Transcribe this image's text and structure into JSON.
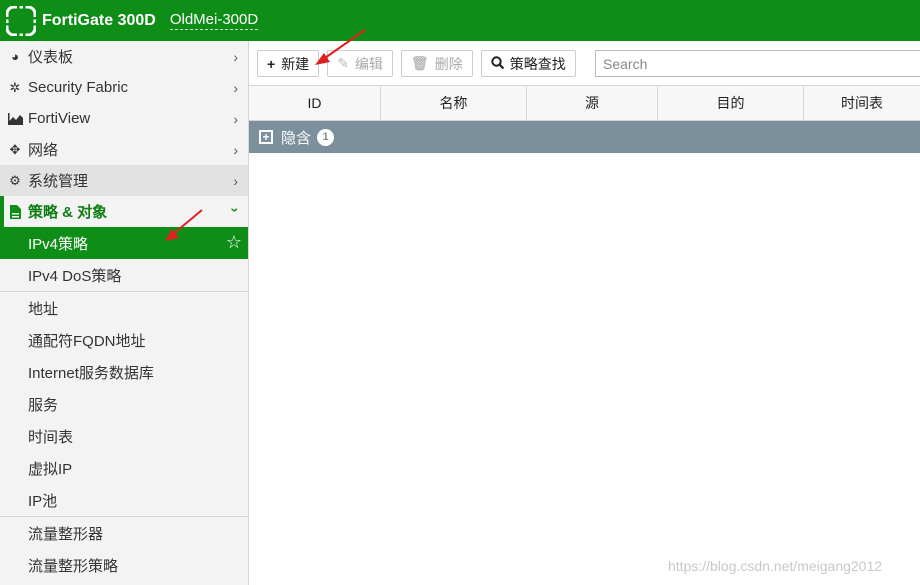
{
  "header": {
    "product": "FortiGate 300D",
    "hostname": "OldMei-300D",
    "accent": "#0e8e17"
  },
  "sidebar": {
    "items": [
      {
        "label": "仪表板",
        "icon": "dashboard-icon"
      },
      {
        "label": "Security Fabric",
        "icon": "security-fabric-icon"
      },
      {
        "label": "FortiView",
        "icon": "fortiview-icon"
      },
      {
        "label": "网络",
        "icon": "network-icon"
      },
      {
        "label": "系统管理",
        "icon": "gear-icon"
      },
      {
        "label": "策略 & 对象",
        "icon": "policy-icon"
      }
    ],
    "sub_items": [
      {
        "label": "IPv4策略"
      },
      {
        "label": "IPv4 DoS策略"
      },
      {
        "label": "地址"
      },
      {
        "label": "通配符FQDN地址"
      },
      {
        "label": "Internet服务数据库"
      },
      {
        "label": "服务"
      },
      {
        "label": "时间表"
      },
      {
        "label": "虚拟IP"
      },
      {
        "label": "IP池"
      },
      {
        "label": "流量整形器"
      },
      {
        "label": "流量整形策略"
      }
    ]
  },
  "toolbar": {
    "new_label": "新建",
    "edit_label": "编辑",
    "delete_label": "删除",
    "find_label": "策略查找",
    "search_placeholder": "Search"
  },
  "table": {
    "columns": [
      "ID",
      "名称",
      "源",
      "目的",
      "时间表"
    ],
    "group": {
      "label": "隐含",
      "count": "1"
    }
  },
  "watermark": "https://blog.csdn.net/meigang2012"
}
